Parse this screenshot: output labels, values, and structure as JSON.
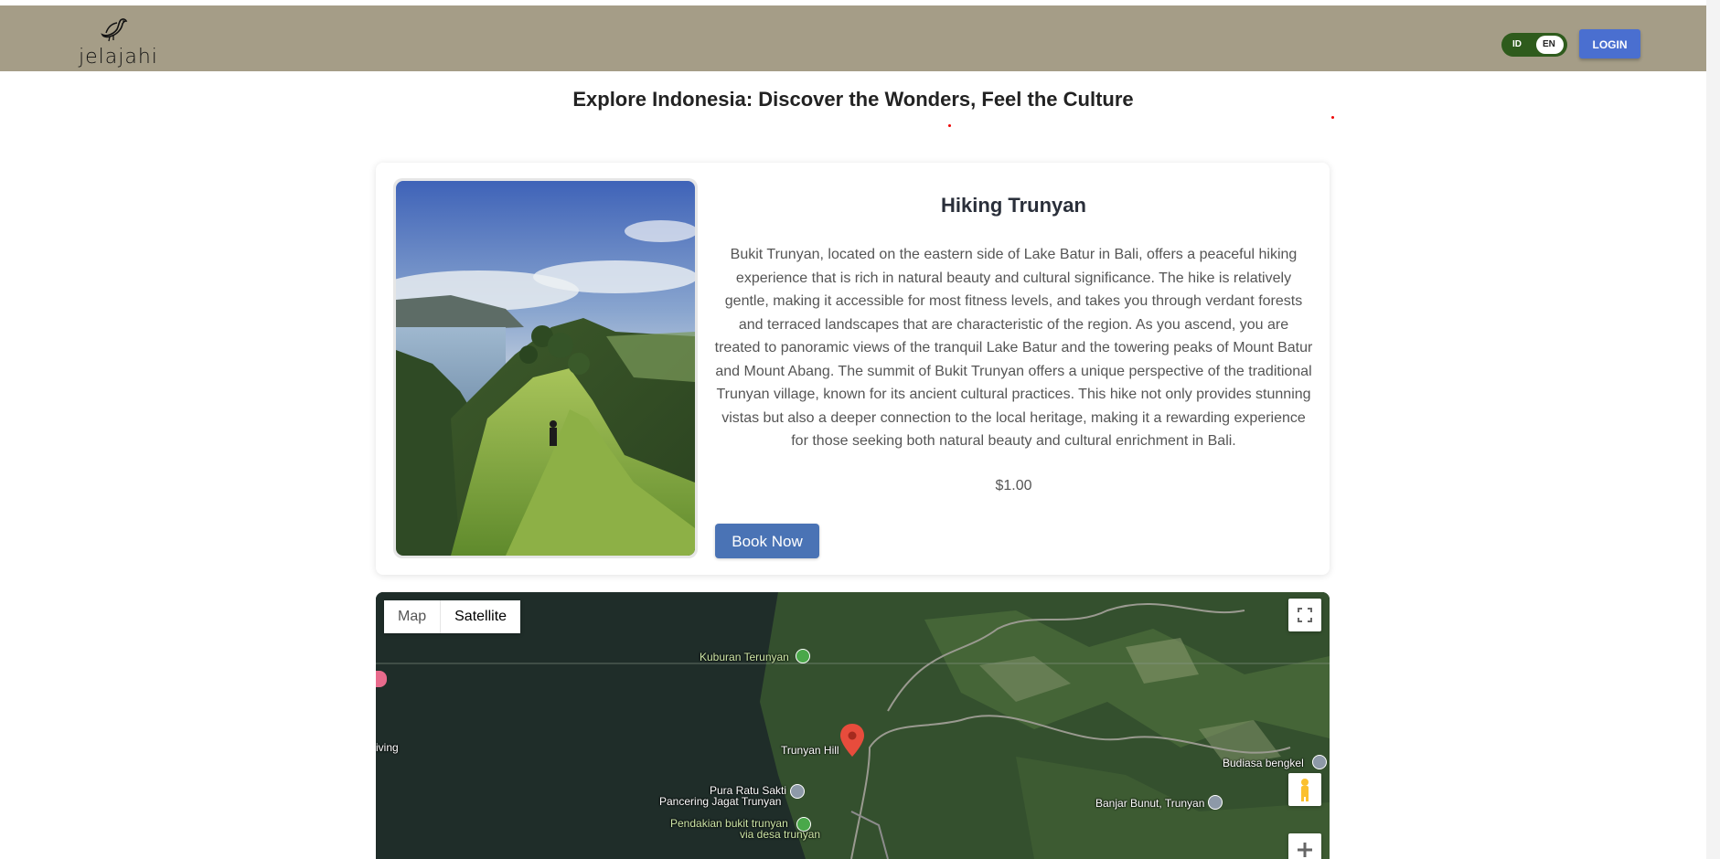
{
  "header": {
    "logo_text": "jelajahi",
    "lang_id": "ID",
    "lang_en": "EN",
    "login_label": "LOGIN",
    "colors": {
      "header_bg": "#a59d87",
      "login_bg": "#4a6fd0",
      "toggle_bg": "#2e5b1c"
    }
  },
  "page": {
    "title": "Explore Indonesia: Discover the Wonders, Feel the Culture"
  },
  "tour": {
    "title": "Hiking Trunyan",
    "description": "Bukit Trunyan, located on the eastern side of Lake Batur in Bali, offers a peaceful hiking experience that is rich in natural beauty and cultural significance. The hike is relatively gentle, making it accessible for most fitness levels, and takes you through verdant forests and terraced landscapes that are characteristic of the region. As you ascend, you are treated to panoramic views of the tranquil Lake Batur and the towering peaks of Mount Batur and Mount Abang. The summit of Bukit Trunyan offers a unique perspective of the traditional Trunyan village, known for its ancient cultural practices. This hike not only provides stunning vistas but also a deeper connection to the local heritage, making it a rewarding experience for those seeking both natural beauty and cultural enrichment in Bali.",
    "price": "$1.00",
    "book_label": "Book Now",
    "button_color": "#4a73b5"
  },
  "map": {
    "type_map": "Map",
    "type_satellite": "Satellite",
    "selected_type": "Satellite",
    "labels": {
      "kuburan": "Kuburan Terunyan",
      "trunyan_hill": "Trunyan Hill",
      "iving": "iving",
      "pura_1": "Pura Ratu Sakti",
      "pura_2": "Pancering Jagat Trunyan",
      "pendakian_1": "Pendakian bukit trunyan",
      "pendakian_2": "via desa trunyan",
      "budiasa": "Budiasa bengkel",
      "banjar": "Banjar Bunut, Trunyan"
    },
    "controls": [
      "fullscreen-icon",
      "pegman-icon",
      "zoom-in-icon"
    ]
  }
}
